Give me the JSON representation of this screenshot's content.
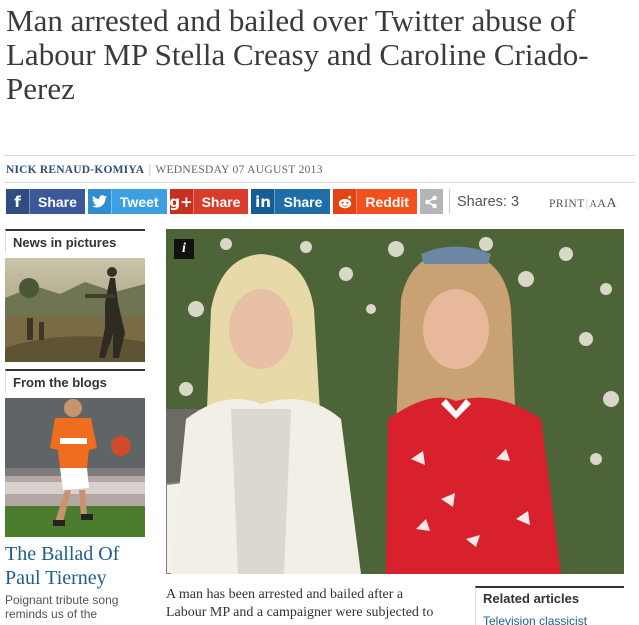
{
  "article": {
    "headline": "Man arrested and bailed over Twitter abuse of Labour MP Stella Creasy and Caroline Criado-Perez",
    "author": "NICK RENAUD-KOMIYA",
    "date": "WEDNESDAY 07 AUGUST 2013",
    "body_lines": [
      "A man has been arrested and bailed after a",
      "Labour MP and a campaigner were subjected to"
    ]
  },
  "share": {
    "buttons": [
      {
        "name": "facebook",
        "icon": "facebook-icon",
        "glyph": "f",
        "label": "Share"
      },
      {
        "name": "twitter",
        "icon": "twitter-icon",
        "glyph": "🐦",
        "label": "Tweet"
      },
      {
        "name": "googleplus",
        "icon": "googleplus-icon",
        "glyph": "g+",
        "label": "Share"
      },
      {
        "name": "linkedin",
        "icon": "linkedin-icon",
        "glyph": "in",
        "label": "Share"
      },
      {
        "name": "reddit",
        "icon": "reddit-icon",
        "glyph": "☻",
        "label": "Reddit"
      }
    ],
    "count_text": "Shares: 3"
  },
  "tools": {
    "print": "PRINT",
    "sizes": [
      "A",
      "A",
      "A"
    ]
  },
  "sidebar": {
    "news_in_pictures": "News in pictures",
    "from_the_blogs": "From the blogs",
    "blog_title": "The Ballad Of Paul Tierney",
    "blog_desc": "Poignant tribute song reminds us of the"
  },
  "photo": {
    "badge": "i"
  },
  "related": {
    "heading": "Related articles",
    "first_item": "Television classicist"
  },
  "colors": {
    "link": "#1f5d8e",
    "facebook": "#3b5998",
    "twitter": "#3ea0e0",
    "googleplus": "#d73c2c",
    "linkedin": "#1f6ea8",
    "reddit": "#f4501e"
  }
}
